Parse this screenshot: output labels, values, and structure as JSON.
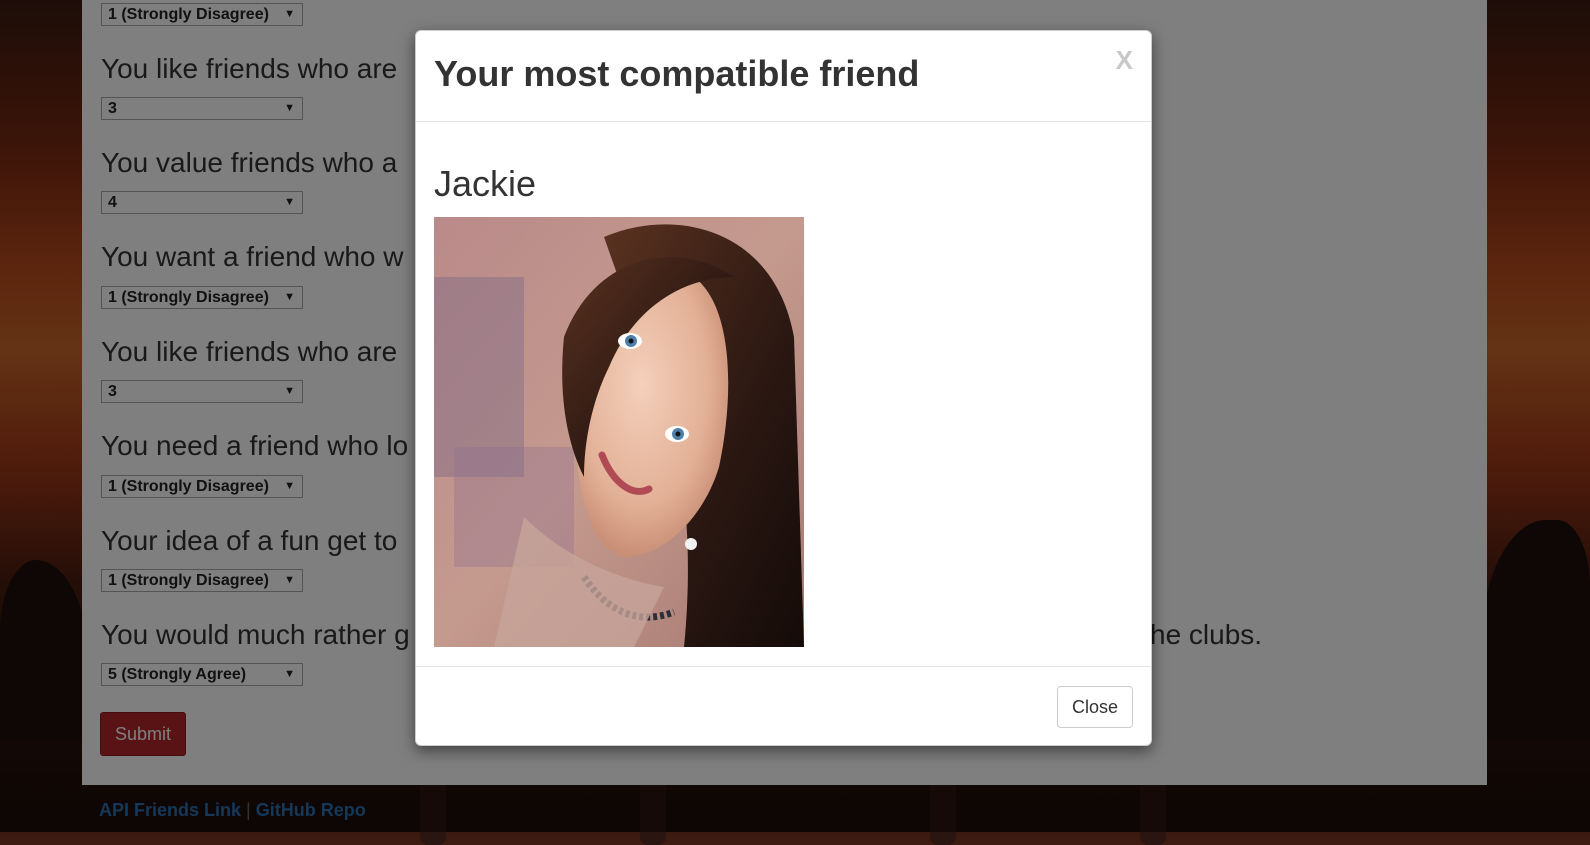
{
  "survey": {
    "questions": [
      {
        "text": "",
        "answer": "1 (Strongly Disagree)"
      },
      {
        "text": "You like friends who are",
        "answer": "3"
      },
      {
        "text": "You value friends who a",
        "answer": "4"
      },
      {
        "text": "You want a friend who w",
        "answer": "1 (Strongly Disagree)"
      },
      {
        "text": "You like friends who are",
        "answer": "3"
      },
      {
        "text": "You need a friend who lo",
        "answer": "1 (Strongly Disagree)"
      },
      {
        "text": "Your idea of a fun get to",
        "answer": "1 (Strongly Disagree)"
      },
      {
        "text": "You would much rather g",
        "text_tail": "he clubs.",
        "answer": "5 (Strongly Agree)"
      }
    ],
    "submit_label": "Submit"
  },
  "footer": {
    "api_link": "API Friends Link",
    "separator": "|",
    "github_link": "GitHub Repo"
  },
  "modal": {
    "title": "Your most compatible friend",
    "close_x": "X",
    "friend_name": "Jackie",
    "photo_alt": "Jackie profile photo",
    "close_label": "Close"
  },
  "colors": {
    "submit_bg": "#b3262a",
    "link": "#2a6fb0",
    "backdrop": "rgba(0,0,0,0.5)"
  }
}
